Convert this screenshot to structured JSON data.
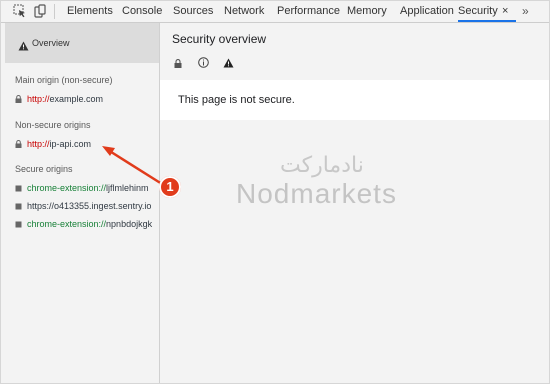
{
  "toolbar": {
    "tabs": [
      "Elements",
      "Console",
      "Sources",
      "Network",
      "Performance",
      "Memory",
      "Application",
      "Security"
    ],
    "active_tab": "Security",
    "close_glyph": "×",
    "more_glyph": "»",
    "icons": [
      "inspect-element-icon",
      "device-toolbar-icon"
    ]
  },
  "sidebar": {
    "overview_label": "Overview",
    "main_origin_heading": "Main origin (non-secure)",
    "main_origin": {
      "scheme": "http://",
      "host": "example.com"
    },
    "nonsecure_heading": "Non-secure origins",
    "nonsecure_origins": [
      {
        "scheme": "http://",
        "host": "ip-api.com"
      }
    ],
    "secure_heading": "Secure origins",
    "secure_origins": [
      {
        "scheme": "chrome-extension://",
        "host": "ljflmlehinm"
      },
      {
        "scheme": "https://",
        "host": "o413355.ingest.sentry.io"
      },
      {
        "scheme": "chrome-extension://",
        "host": "npnbdojkgk"
      }
    ]
  },
  "main": {
    "title": "Security overview",
    "banner_text": "This page is not secure."
  },
  "watermark": {
    "persian": "نادمارکت",
    "english": "Nodmarkets"
  },
  "annotation": {
    "number": "1"
  },
  "colors": {
    "insecure_scheme": "#c80000",
    "secure_scheme": "#188038",
    "active_tab_underline": "#1a73e8",
    "annotation": "#e13b1b"
  }
}
